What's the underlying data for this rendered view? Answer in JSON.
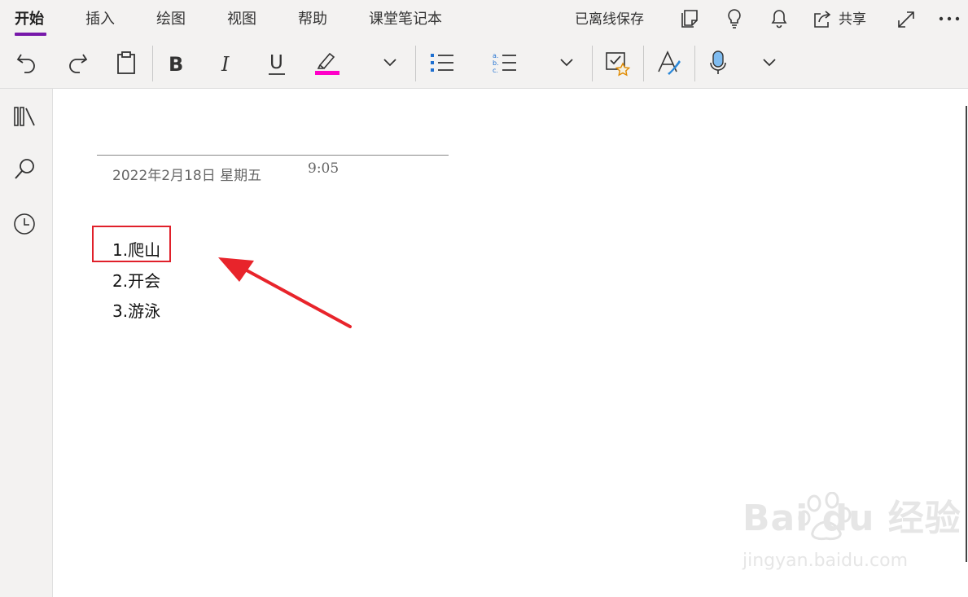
{
  "ribbon": {
    "tabs": [
      {
        "label": "开始"
      },
      {
        "label": "插入"
      },
      {
        "label": "绘图"
      },
      {
        "label": "视图"
      },
      {
        "label": "帮助"
      },
      {
        "label": "课堂笔记本"
      }
    ],
    "status": "已离线保存",
    "share_label": "共享",
    "highlight_color": "#ff00c8",
    "accent_color": "#7719aa"
  },
  "note": {
    "date": "2022年2月18日 星期五",
    "time": "9:05",
    "items": [
      {
        "text": "1.爬山"
      },
      {
        "text": "2.开会"
      },
      {
        "text": "3.游泳"
      }
    ]
  },
  "annotation": {
    "box_color": "#e0202a"
  },
  "watermark": {
    "logo": "Bai  du 经验",
    "url": "jingyan.baidu.com"
  }
}
